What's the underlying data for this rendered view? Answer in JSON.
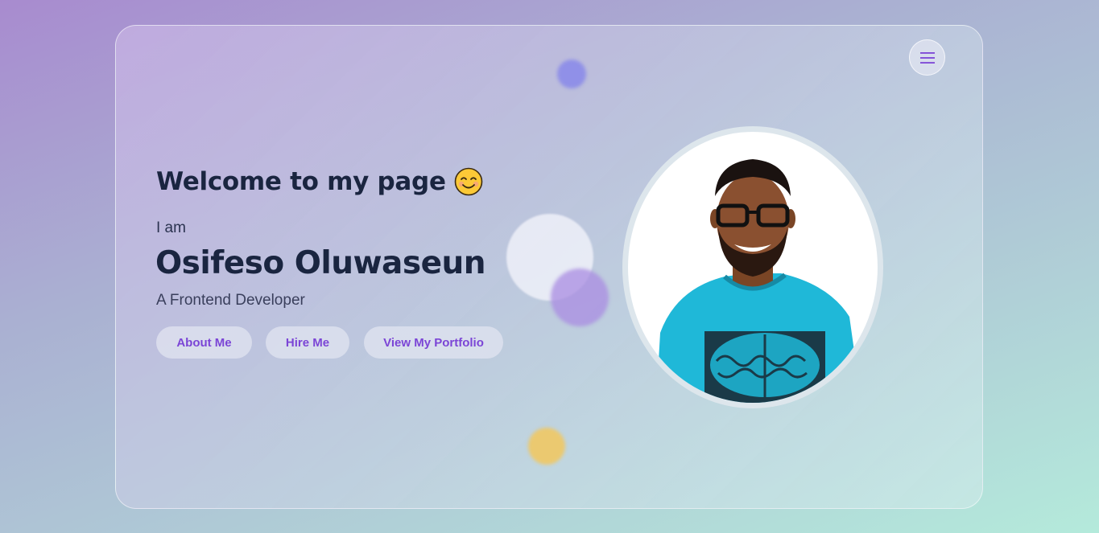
{
  "hero": {
    "welcome_text": "Welcome to my page",
    "welcome_emoji": "😊",
    "intro": "I am",
    "name": "Osifeso Oluwaseun",
    "role": "A Frontend Developer"
  },
  "buttons": {
    "about": "About Me",
    "hire": "Hire Me",
    "portfolio": "View My Portfolio"
  },
  "menu": {
    "icon": "hamburger-menu-icon"
  },
  "colors": {
    "accent": "#7b45d6",
    "heading": "#1a2540",
    "shirt": "#1fb8d8"
  },
  "photo": {
    "alt": "profile-photo"
  }
}
